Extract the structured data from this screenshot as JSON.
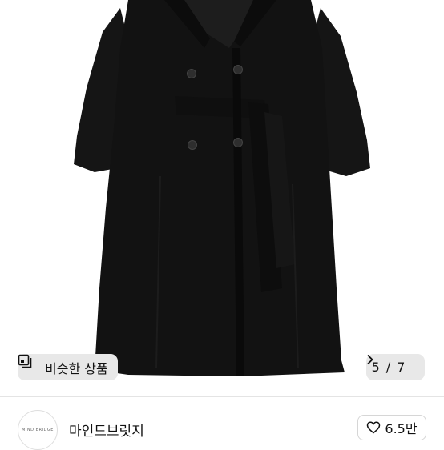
{
  "product_image": {
    "subject": "black-double-breasted-belted-long-coat"
  },
  "similar_button": {
    "label": "비슷한 상품",
    "icon": "similar-items-icon"
  },
  "image_counter": {
    "current": "5",
    "separator": "/",
    "total": "7",
    "icon": "chevron-right-icon"
  },
  "shop": {
    "avatar_text": "MIND BRIDGE",
    "name": "마인드브릿지",
    "likes": "6.5만",
    "like_icon": "heart-icon"
  },
  "colors": {
    "coat": "#141414",
    "chip_bg": "#e8e8e8",
    "border": "#d6d6d6"
  }
}
